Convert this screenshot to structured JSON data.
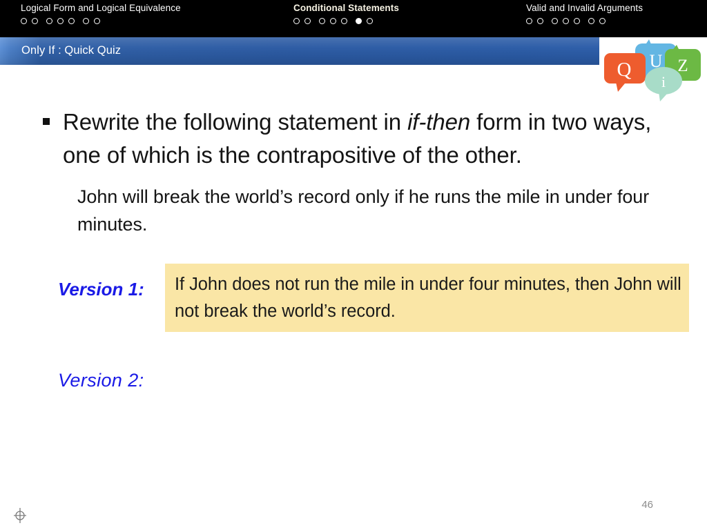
{
  "slide": {
    "page_number": "46"
  },
  "nav": {
    "groups": [
      {
        "title": "Logical Form and Logical Equivalence",
        "current": false,
        "dots": [
          {
            "active": false,
            "gap": false
          },
          {
            "active": false,
            "gap": false
          },
          {
            "active": false,
            "gap": true
          },
          {
            "active": false,
            "gap": false
          },
          {
            "active": false,
            "gap": false
          },
          {
            "active": false,
            "gap": true
          },
          {
            "active": false,
            "gap": false
          }
        ]
      },
      {
        "title": "Conditional Statements",
        "current": true,
        "dots": [
          {
            "active": false,
            "gap": false
          },
          {
            "active": false,
            "gap": false
          },
          {
            "active": false,
            "gap": true
          },
          {
            "active": false,
            "gap": false
          },
          {
            "active": false,
            "gap": false
          },
          {
            "active": true,
            "gap": true
          },
          {
            "active": false,
            "gap": false
          }
        ]
      },
      {
        "title": "Valid and Invalid Arguments",
        "current": false,
        "dots": [
          {
            "active": false,
            "gap": false
          },
          {
            "active": false,
            "gap": false
          },
          {
            "active": false,
            "gap": true
          },
          {
            "active": false,
            "gap": false
          },
          {
            "active": false,
            "gap": false
          },
          {
            "active": false,
            "gap": true
          },
          {
            "active": false,
            "gap": false
          }
        ]
      }
    ]
  },
  "header": {
    "title": "Only If : Quick Quiz",
    "bar_color": "#2b5aa3",
    "logo": {
      "name": "quiz-logo",
      "letters": [
        "Q",
        "U",
        "Z",
        "i"
      ],
      "colors": [
        "#ee5c2e",
        "#63b6e3",
        "#6cb944",
        "#a8dcc8"
      ]
    }
  },
  "body": {
    "instruction_prefix": "Rewrite the following statement in ",
    "instruction_emphasis": "if-then",
    "instruction_suffix": " form in two ways, one of which is the contrapositive of the other.",
    "statement": "John will break the world’s record only if he runs the mile in under four minutes.",
    "versions": [
      {
        "label": "Version 1:",
        "answer": "If John does not run the mile in under four minutes, then John will not break the world’s record.",
        "highlight_color": "#fae6a6",
        "has_answer": true
      },
      {
        "label": "Version 2:",
        "answer": "",
        "highlight_color": "#fae6a6",
        "has_answer": false
      }
    ]
  }
}
